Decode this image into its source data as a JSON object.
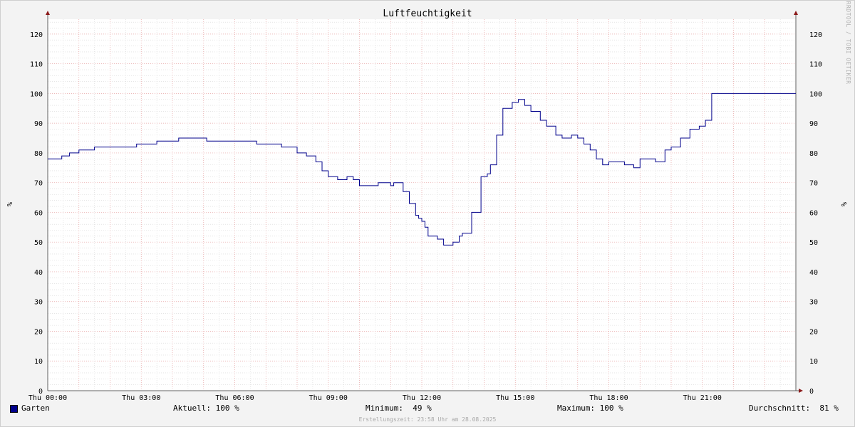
{
  "chart_data": {
    "type": "line",
    "title": "Luftfeuchtigkeit",
    "ylabel": "%",
    "ylim": [
      0,
      125
    ],
    "yticks": [
      0,
      10,
      20,
      30,
      40,
      50,
      60,
      70,
      80,
      90,
      100,
      110,
      120
    ],
    "xlim": [
      0,
      24
    ],
    "xticks": [
      {
        "hour": 0,
        "label": "Thu 00:00"
      },
      {
        "hour": 3,
        "label": "Thu 03:00"
      },
      {
        "hour": 6,
        "label": "Thu 06:00"
      },
      {
        "hour": 9,
        "label": "Thu 09:00"
      },
      {
        "hour": 12,
        "label": "Thu 12:00"
      },
      {
        "hour": 15,
        "label": "Thu 15:00"
      },
      {
        "hour": 18,
        "label": "Thu 18:00"
      },
      {
        "hour": 21,
        "label": "Thu 21:00"
      }
    ],
    "grid": true,
    "color": "#00008b",
    "series": [
      {
        "name": "Garten",
        "x": [
          0,
          0.4,
          0.45,
          0.7,
          1.0,
          1.45,
          1.5,
          1.6,
          2.0,
          2.4,
          2.85,
          2.9,
          3.0,
          3.5,
          3.6,
          4.1,
          4.2,
          4.5,
          4.6,
          5.0,
          5.1,
          5.5,
          6.0,
          6.5,
          6.7,
          6.8,
          7.4,
          7.5,
          7.9,
          8.0,
          8.3,
          8.6,
          8.8,
          9.0,
          9.3,
          9.6,
          9.8,
          10.0,
          10.4,
          10.6,
          10.8,
          11.0,
          11.1,
          11.2,
          11.4,
          11.6,
          11.8,
          11.9,
          12.0,
          12.1,
          12.2,
          12.5,
          12.7,
          13.0,
          13.2,
          13.3,
          13.6,
          13.9,
          14.1,
          14.2,
          14.4,
          14.6,
          14.9,
          15.1,
          15.3,
          15.5,
          15.8,
          16.0,
          16.3,
          16.5,
          16.8,
          17.0,
          17.2,
          17.4,
          17.6,
          17.8,
          18.0,
          18.5,
          18.8,
          19.0,
          19.2,
          19.5,
          19.8,
          20.0,
          20.3,
          20.6,
          20.9,
          21.1,
          21.3,
          24.0
        ],
        "y": [
          78,
          78,
          79,
          80,
          81,
          81,
          82,
          82,
          82,
          82,
          83,
          83,
          83,
          84,
          84,
          84,
          85,
          85,
          85,
          85,
          84,
          84,
          84,
          84,
          83,
          83,
          83,
          82,
          82,
          80,
          79,
          77,
          74,
          72,
          71,
          72,
          71,
          69,
          69,
          70,
          70,
          69,
          70,
          70,
          67,
          63,
          59,
          58,
          57,
          55,
          52,
          51,
          49,
          50,
          52,
          53,
          60,
          72,
          73,
          76,
          86,
          95,
          97,
          98,
          96,
          94,
          91,
          89,
          86,
          85,
          86,
          85,
          83,
          81,
          78,
          76,
          77,
          76,
          75,
          78,
          78,
          77,
          81,
          82,
          85,
          88,
          89,
          91,
          100,
          100
        ]
      }
    ]
  },
  "legend": {
    "series_name": "Garten",
    "current": "Aktuell: 100 %",
    "minimum": "Minimum:  49 %",
    "maximum": "Maximum: 100 %",
    "average": "Durchschnitt:  81 %"
  },
  "watermark": "RRDTOOL / TOBI OETIKER",
  "footer": "Erstellungszeit: 23:58 Uhr am 28.08.2025"
}
